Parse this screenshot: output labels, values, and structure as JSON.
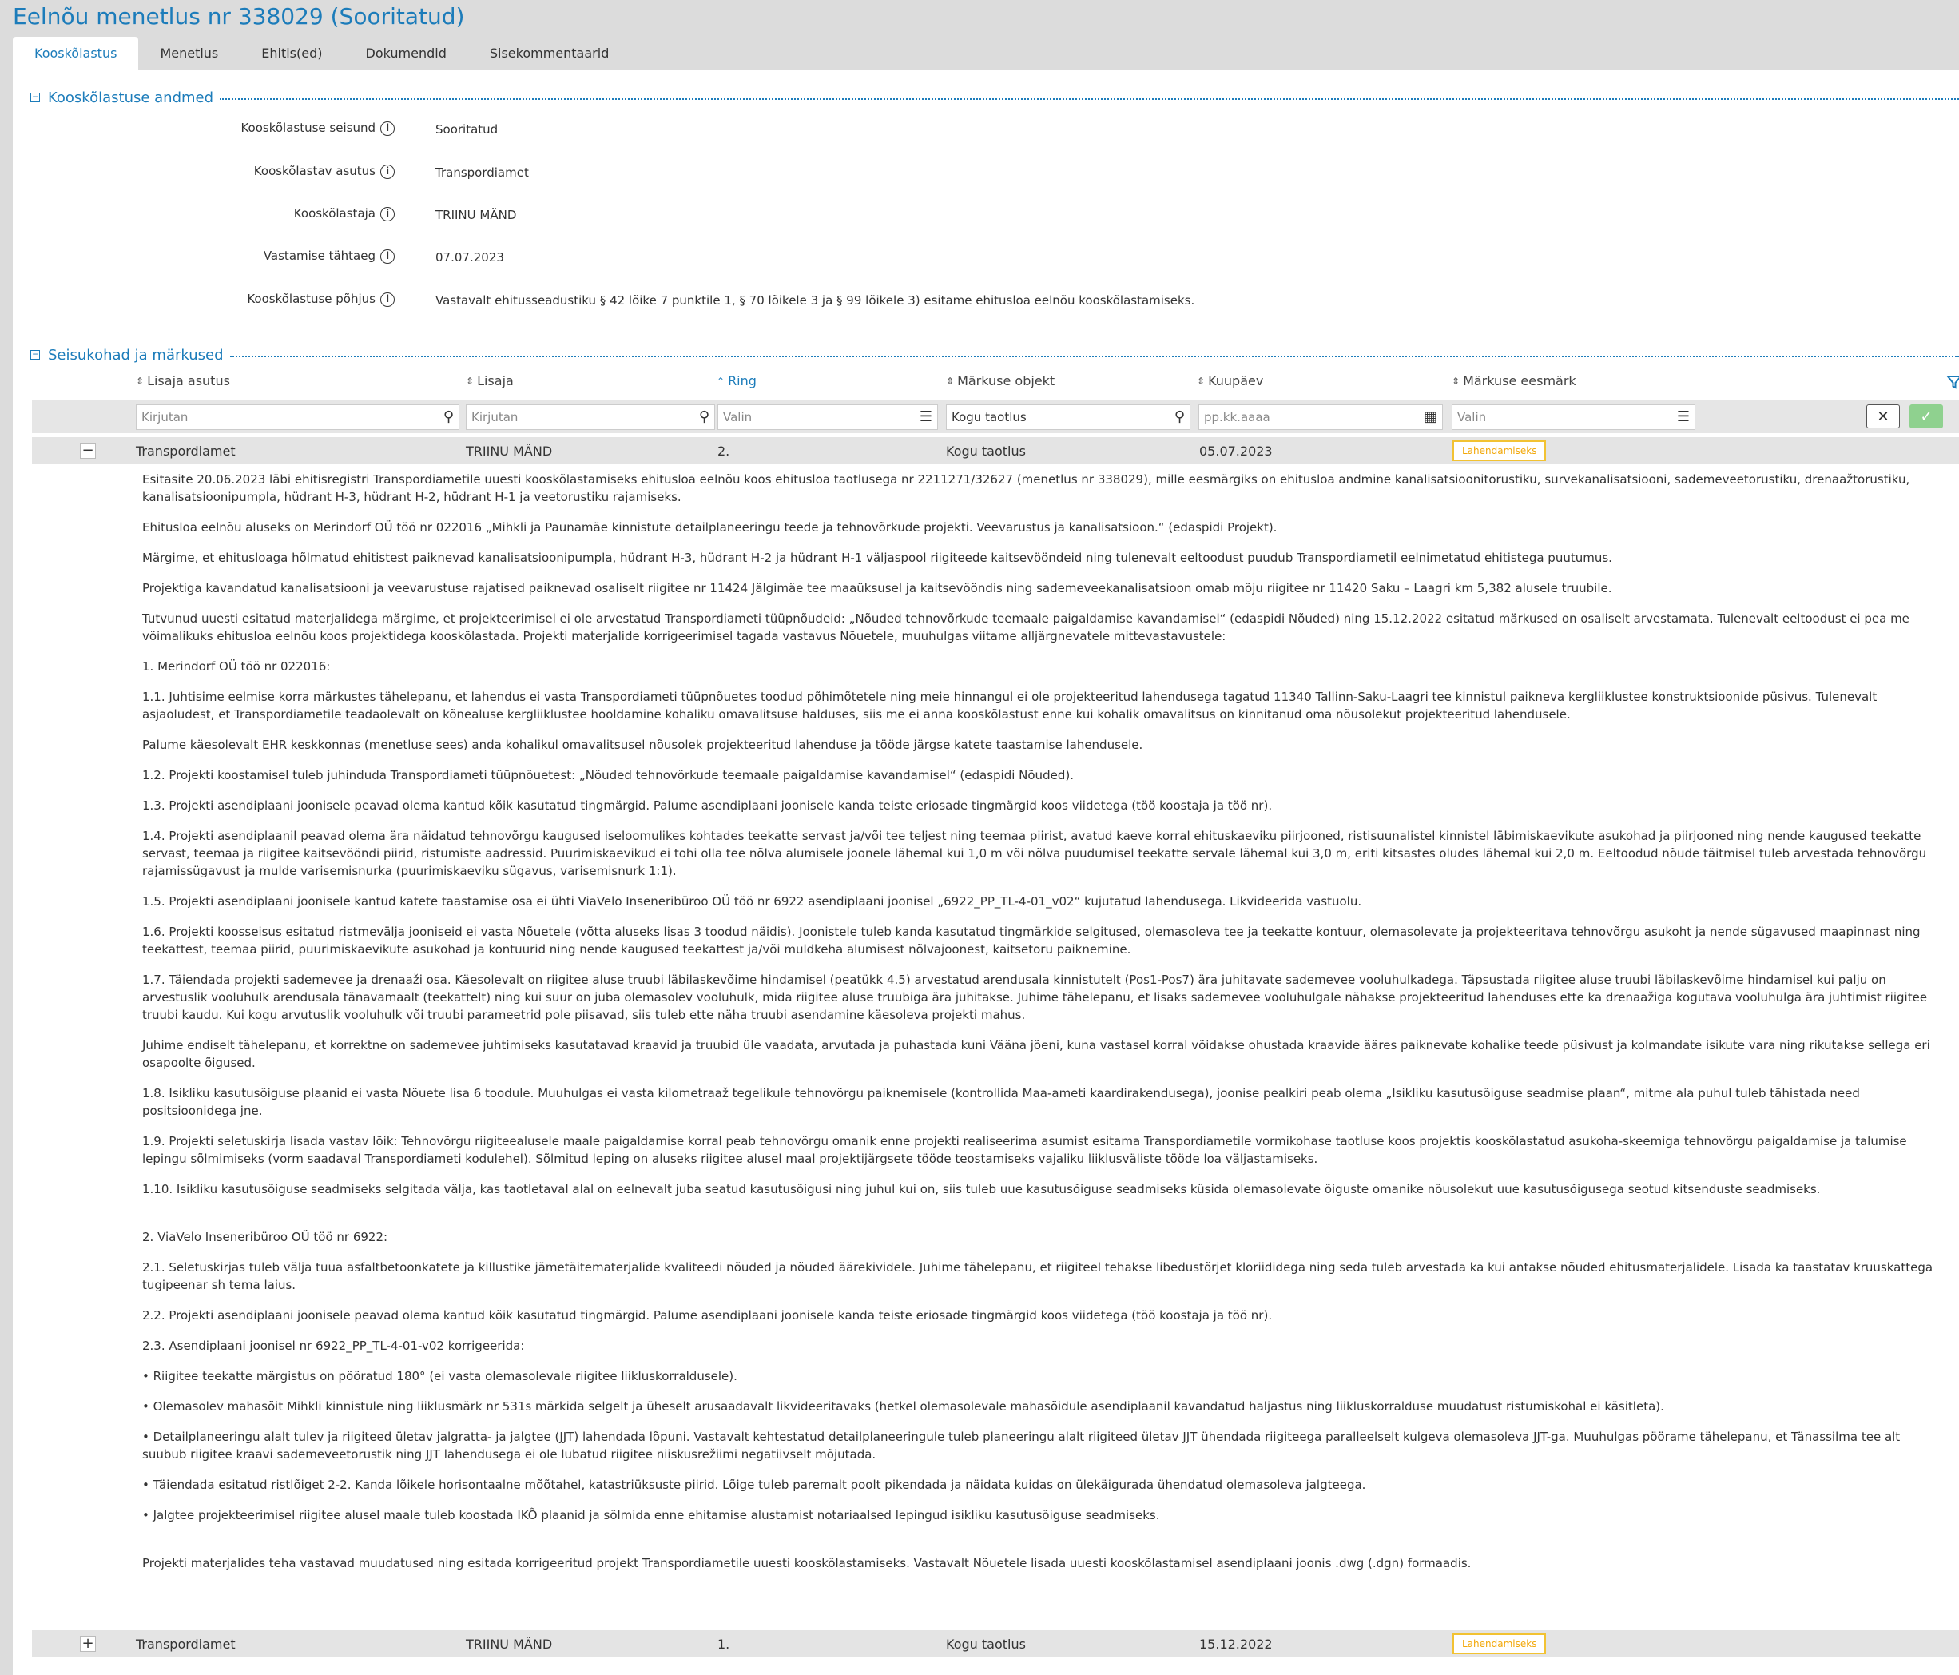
{
  "header": {
    "title": "Eelnõu menetlus nr 338029 (Sooritatud)",
    "tabs": [
      "Kooskõlastus",
      "Menetlus",
      "Ehitis(ed)",
      "Dokumendid",
      "Sisekommentaarid"
    ],
    "active_tab": "Kooskõlastus"
  },
  "section1": {
    "title": "Kooskõlastuse andmed",
    "fields": [
      {
        "label": "Kooskõlastuse seisund",
        "value": "Sooritatud"
      },
      {
        "label": "Kooskõlastav asutus",
        "value": "Transpordiamet"
      },
      {
        "label": "Kooskõlastaja",
        "value": "TRIINU MÄND"
      },
      {
        "label": "Vastamise tähtaeg",
        "value": "07.07.2023"
      },
      {
        "label": "Kooskõlastuse põhjus",
        "value": "Vastavalt ehitusseadustiku § 42 lõike 7 punktile 1, § 70 lõikele 3 ja § 99 lõikele 3) esitame ehitusloa eelnõu kooskõlastamiseks."
      }
    ]
  },
  "section2": {
    "title": "Seisukohad ja märkused",
    "columns": [
      "Lisaja asutus",
      "Lisaja",
      "Ring",
      "Märkuse objekt",
      "Kuupäev",
      "Märkuse eesmärk"
    ],
    "filters": {
      "lisaja_asutus": "Kirjutan",
      "lisaja": "Kirjutan",
      "ring": "Valin",
      "objekt": "Kogu taotlus",
      "kuupaev": "pp.kk.aaaa",
      "eesmark": "Valin"
    },
    "rows": [
      {
        "toggle": "−",
        "asutus": "Transpordiamet",
        "lisaja": "TRIINU MÄND",
        "ring": "2.",
        "objekt": "Kogu taotlus",
        "kuupaev": "05.07.2023",
        "eesmark": "Lahendamiseks"
      },
      {
        "toggle": "+",
        "asutus": "Transpordiamet",
        "lisaja": "TRIINU MÄND",
        "ring": "1.",
        "objekt": "Kogu taotlus",
        "kuupaev": "15.12.2022",
        "eesmark": "Lahendamiseks"
      }
    ],
    "comment": [
      "Esitasite 20.06.2023 läbi ehitisregistri Transpordiametile uuesti kooskõlastamiseks ehitusloa eelnõu koos ehitusloa taotlusega nr 2211271/32627 (menetlus nr 338029), mille eesmärgiks on ehitusloa andmine kanalisatsioonitorustiku, survekanalisatsiooni, sademeveetorustiku, drenaažtorustiku, kanalisatsioonipumpla, hüdrant H-3, hüdrant H-2, hüdrant H-1 ja veetorustiku rajamiseks.",
      "Ehitusloa eelnõu aluseks on Merindorf OÜ töö nr 022016 „Mihkli ja Paunamäe kinnistute detailplaneeringu teede ja tehnovõrkude projekti. Veevarustus ja kanalisatsioon.“ (edaspidi Projekt).",
      "Märgime, et ehitusloaga hõlmatud ehitistest paiknevad kanalisatsioonipumpla, hüdrant H-3, hüdrant H-2 ja hüdrant H-1 väljaspool riigiteede kaitsevööndeid ning tulenevalt eeltoodust puudub Transpordiametil eelnimetatud ehitistega puutumus.",
      "Projektiga kavandatud kanalisatsiooni ja veevarustuse rajatised paiknevad osaliselt riigitee nr 11424 Jälgimäe tee maaüksusel ja kaitsevööndis ning sademeveekanalisatsioon omab mõju riigitee nr 11420 Saku – Laagri km 5,382 alusele truubile.",
      "Tutvunud uuesti esitatud materjalidega märgime, et projekteerimisel ei ole arvestatud Transpordiameti tüüpnõudeid: „Nõuded tehnovõrkude teemaale paigaldamise kavandamisel“ (edaspidi Nõuded) ning 15.12.2022 esitatud märkused on osaliselt arvestamata. Tulenevalt eeltoodust ei pea me võimalikuks ehitusloa eelnõu koos projektidega kooskõlastada. Projekti materjalide korrigeerimisel tagada vastavus Nõuetele, muuhulgas viitame alljärgnevatele mittevastavustele:",
      "1. Merindorf OÜ töö nr 022016:",
      "1.1. Juhtisime eelmise korra märkustes tähelepanu, et lahendus ei vasta Transpordiameti tüüpnõuetes toodud põhimõtetele ning meie hinnangul ei ole projekteeritud lahendusega tagatud 11340 Tallinn-Saku-Laagri tee kinnistul paikneva kergliiklustee konstruktsioonide püsivus. Tulenevalt asjaoludest, et Transpordiametile teadaolevalt on kõnealuse kergliiklustee hooldamine kohaliku omavalitsuse halduses, siis me ei anna kooskõlastust enne kui kohalik omavalitsus on kinnitanud oma nõusolekut projekteeritud lahendusele.",
      "Palume käesolevalt EHR keskkonnas (menetluse sees) anda kohalikul omavalitsusel nõusolek projekteeritud lahenduse ja tööde järgse katete taastamise lahendusele.",
      "1.2. Projekti koostamisel tuleb juhinduda Transpordiameti tüüpnõuetest: „Nõuded tehnovõrkude teemaale paigaldamise kavandamisel“ (edaspidi Nõuded).",
      "1.3. Projekti asendiplaani joonisele peavad olema kantud kõik kasutatud tingmärgid. Palume asendiplaani joonisele kanda teiste eriosade tingmärgid koos viidetega (töö koostaja ja töö nr).",
      "1.4. Projekti asendiplaanil peavad olema ära näidatud tehnovõrgu kaugused iseloomulikes kohtades teekatte servast ja/või tee teljest ning teemaa piirist, avatud kaeve korral ehituskaeviku piirjooned, ristisuunalistel kinnistel läbimiskaevikute asukohad ja piirjooned ning nende kaugused teekatte servast, teemaa ja riigitee kaitsevööndi piirid, ristumiste aadressid. Puurimiskaevikud ei tohi olla tee nõlva alumisele joonele lähemal kui 1,0 m või nõlva puudumisel teekatte servale lähemal kui 3,0 m, eriti kitsastes oludes lähemal kui 2,0 m. Eeltoodud nõude täitmisel tuleb arvestada tehnovõrgu rajamissügavust ja mulde varisemisnurka (puurimiskaeviku sügavus, varisemisnurk 1:1).",
      "1.5. Projekti asendiplaani joonisele kantud katete taastamise osa ei ühti ViaVelo Inseneribüroo OÜ töö nr 6922 asendiplaani joonisel „6922_PP_TL-4-01_v02“ kujutatud lahendusega. Likvideerida vastuolu.",
      "1.6. Projekti koosseisus esitatud ristmevälja jooniseid ei vasta Nõuetele (võtta aluseks lisas 3 toodud näidis). Joonistele tuleb kanda kasutatud tingmärkide selgitused, olemasoleva tee ja teekatte kontuur, olemasolevate ja projekteeritava tehnovõrgu asukoht ja nende sügavused maapinnast ning teekattest, teemaa piirid, puurimiskaevikute asukohad ja kontuurid ning nende kaugused teekattest ja/või muldkeha alumisest nõlvajoonest, kaitsetoru paiknemine.",
      "1.7. Täiendada projekti sademevee ja drenaaži osa. Käesolevalt on riigitee aluse truubi läbilaskevõime hindamisel (peatükk 4.5) arvestatud arendusala kinnistutelt (Pos1-Pos7) ära juhitavate sademevee vooluhulkadega. Täpsustada riigitee aluse truubi läbilaskevõime hindamisel kui palju on arvestuslik vooluhulk arendusala tänavamaalt (teekattelt) ning kui suur on juba olemasolev vooluhulk, mida riigitee aluse truubiga ära juhitakse. Juhime tähelepanu, et lisaks sademevee vooluhulgale nähakse projekteeritud lahenduses ette ka drenaažiga kogutava vooluhulga ära juhtimist riigitee truubi kaudu. Kui kogu arvutuslik vooluhulk või truubi parameetrid pole piisavad, siis tuleb ette näha truubi asendamine käesoleva projekti mahus.",
      "Juhime endiselt tähelepanu, et korrektne on sademevee juhtimiseks kasutatavad kraavid ja truubid üle vaadata, arvutada ja puhastada kuni Vääna jõeni, kuna vastasel korral võidakse ohustada kraavide ääres paiknevate kohalike teede püsivust ja kolmandate isikute vara ning rikutakse sellega eri osapoolte õigused.",
      "1.8. Isikliku kasutusõiguse plaanid ei vasta Nõuete lisa 6 toodule. Muuhulgas ei vasta kilometraaž tegelikule tehnovõrgu paiknemisele (kontrollida Maa-ameti kaardirakendusega), joonise pealkiri peab olema „Isikliku kasutusõiguse seadmise plaan“, mitme ala puhul tuleb tähistada need positsioonidega jne.",
      "1.9. Projekti seletuskirja lisada vastav lõik: Tehnovõrgu riigiteealusele maale paigaldamise korral peab tehnovõrgu omanik enne projekti realiseerima asumist esitama Transpordiametile vormikohase taotluse koos projektis kooskõlastatud asukoha-skeemiga tehnovõrgu paigaldamise ja talumise lepingu sõlmimiseks (vorm saadaval Transpordiameti kodulehel). Sõlmitud leping on aluseks riigitee alusel maal projektijärgsete tööde teostamiseks vajaliku liiklusväliste tööde loa väljastamiseks.",
      "1.10.   Isikliku kasutusõiguse seadmiseks selgitada välja, kas taotletaval alal on eelnevalt juba seatud kasutusõigusi ning juhul kui on, siis tuleb uue kasutusõiguse seadmiseks küsida olemasolevate õiguste omanike nõusolekut uue kasutusõigusega seotud kitsenduste seadmiseks.",
      "2. ViaVelo Inseneribüroo OÜ töö nr 6922:",
      "2.1. Seletuskirjas tuleb välja tuua asfaltbetoonkatete ja killustike jämetäitematerjalide kvaliteedi nõuded ja nõuded äärekividele. Juhime tähelepanu, et riigiteel tehakse libedustõrjet kloriididega ning seda tuleb arvestada ka kui antakse nõuded ehitusmaterjalidele. Lisada ka taastatav kruuskattega tugipeenar sh tema laius.",
      "2.2. Projekti asendiplaani joonisele peavad olema kantud kõik kasutatud tingmärgid. Palume asendiplaani joonisele kanda teiste eriosade tingmärgid koos viidetega (töö koostaja ja töö nr).",
      "2.3. Asendiplaani joonisel nr 6922_PP_TL-4-01-v02 korrigeerida:",
      "•  Riigitee teekatte märgistus on pööratud 180° (ei vasta olemasolevale riigitee liikluskorraldusele).",
      "•  Olemasolev mahasõit Mihkli kinnistule ning liiklusmärk nr 531s märkida selgelt ja üheselt arusaadavalt likvideeritavaks (hetkel olemasolevale mahasõidule asendiplaanil kavandatud haljastus ning liikluskorralduse muudatust ristumiskohal ei käsitleta).",
      "•  Detailplaneeringu alalt tulev ja riigiteed ületav jalgratta- ja jalgtee (JJT) lahendada lõpuni. Vastavalt kehtestatud detailplaneeringule tuleb planeeringu alalt riigiteed ületav JJT ühendada riigiteega paralleelselt kulgeva olemasoleva JJT-ga. Muuhulgas pöörame tähelepanu, et Tänassilma tee alt suubub riigitee kraavi sademeveetorustik ning JJT lahendusega ei ole lubatud riigitee niiskusrežiimi negatiivselt mõjutada.",
      "•  Täiendada esitatud ristlõiget 2-2. Kanda lõikele horisontaalne mõõtahel, katastriüksuste piirid. Lõige tuleb paremalt poolt pikendada ja näidata kuidas on ülekäigurada ühendatud olemasoleva jalgteega.",
      "•  Jalgtee projekteerimisel riigitee alusel maale tuleb koostada IKÕ plaanid ja sõlmida enne ehitamise alustamist notariaalsed lepingud isikliku kasutusõiguse seadmiseks.",
      "Projekti materjalides teha vastavad muudatused ning esitada korrigeeritud projekt Transpordiametile uuesti kooskõlastamiseks. Vastavalt Nõuetele lisada uuesti kooskõlastamisel asendiplaani joonis .dwg (.dgn) formaadis."
    ]
  }
}
